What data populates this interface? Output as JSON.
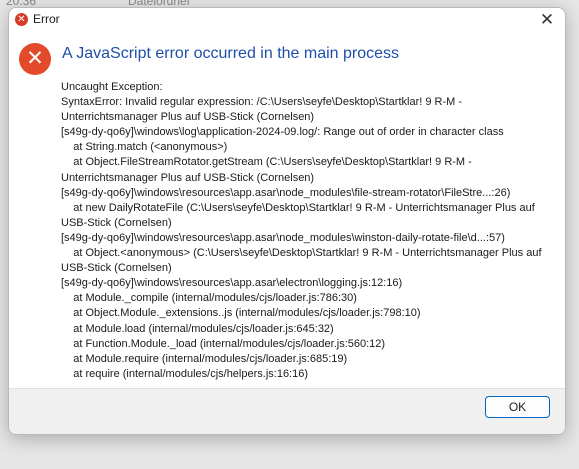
{
  "backdrop": {
    "time_fragment": "20:36",
    "column_fragment": "Dateiordner"
  },
  "window": {
    "title": "Error",
    "close_glyph": "✕",
    "title_icon": "error-icon",
    "title_icon_glyph": "✕"
  },
  "dialog": {
    "icon": "error-icon",
    "icon_glyph": "✕",
    "heading": "A JavaScript error occurred in the main process",
    "message": "Uncaught Exception:\nSyntaxError: Invalid regular expression: /C:\\Users\\seyfe\\Desktop\\Startklar! 9 R-M - Unterrichtsmanager Plus auf USB-Stick (Cornelsen)\n[s49g-dy-qo6y]\\windows\\log\\application-2024-09.log/: Range out of order in character class\n    at String.match (<anonymous>)\n    at Object.FileStreamRotator.getStream (C:\\Users\\seyfe\\Desktop\\Startklar! 9 R-M - Unterrichtsmanager Plus auf USB-Stick (Cornelsen)\n[s49g-dy-qo6y]\\windows\\resources\\app.asar\\node_modules\\file-stream-rotator\\FileStre...:26)\n    at new DailyRotateFile (C:\\Users\\seyfe\\Desktop\\Startklar! 9 R-M - Unterrichtsmanager Plus auf USB-Stick (Cornelsen)\n[s49g-dy-qo6y]\\windows\\resources\\app.asar\\node_modules\\winston-daily-rotate-file\\d...:57)\n    at Object.<anonymous> (C:\\Users\\seyfe\\Desktop\\Startklar! 9 R-M - Unterrichtsmanager Plus auf USB-Stick (Cornelsen)\n[s49g-dy-qo6y]\\windows\\resources\\app.asar\\electron\\logging.js:12:16)\n    at Module._compile (internal/modules/cjs/loader.js:786:30)\n    at Object.Module._extensions..js (internal/modules/cjs/loader.js:798:10)\n    at Module.load (internal/modules/cjs/loader.js:645:32)\n    at Function.Module._load (internal/modules/cjs/loader.js:560:12)\n    at Module.require (internal/modules/cjs/loader.js:685:19)\n    at require (internal/modules/cjs/helpers.js:16:16)"
  },
  "footer": {
    "ok_label": "OK"
  },
  "colors": {
    "error_red": "#e24a2a",
    "heading_blue": "#1f4fa8",
    "button_border": "#0067c0"
  }
}
